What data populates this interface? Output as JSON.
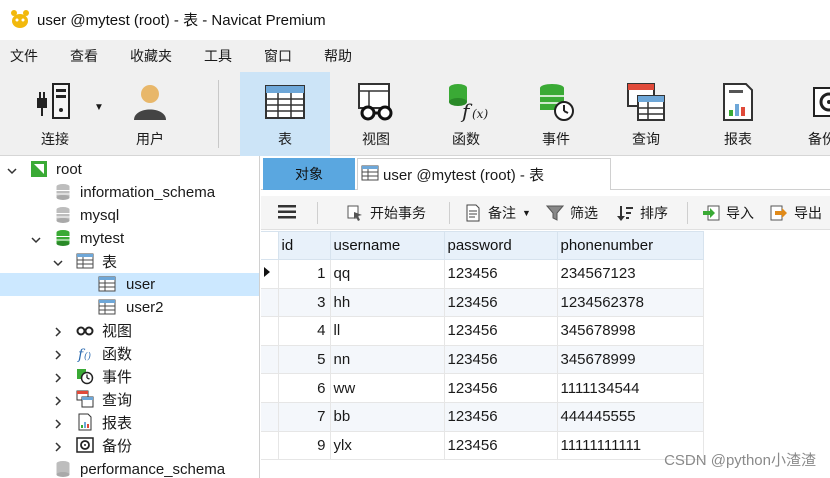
{
  "window": {
    "title": "user @mytest (root) - 表 - Navicat Premium"
  },
  "menu": [
    "文件",
    "查看",
    "收藏夹",
    "工具",
    "窗口",
    "帮助"
  ],
  "toolbar": {
    "connect": "连接",
    "user": "用户",
    "table": "表",
    "view": "视图",
    "function": "函数",
    "event": "事件",
    "query": "查询",
    "report": "报表",
    "backup": "备份"
  },
  "tree": {
    "root": "root",
    "dbs": [
      "information_schema",
      "mysql",
      "mytest"
    ],
    "tables_label": "表",
    "tables": [
      "user",
      "user2"
    ],
    "objects": [
      "视图",
      "函数",
      "事件",
      "查询",
      "报表",
      "备份"
    ],
    "last_db": "performance_schema"
  },
  "tabs": {
    "objects": "对象",
    "current": "user @mytest (root) - 表"
  },
  "objbar": {
    "begin_tx": "开始事务",
    "note": "备注",
    "filter": "筛选",
    "sort": "排序",
    "import": "导入",
    "export": "导出"
  },
  "grid": {
    "columns": [
      "id",
      "username",
      "password",
      "phonenumber"
    ],
    "rows": [
      [
        "1",
        "qq",
        "123456",
        "234567123"
      ],
      [
        "3",
        "hh",
        "123456",
        "1234562378"
      ],
      [
        "4",
        "ll",
        "123456",
        "345678998"
      ],
      [
        "5",
        "nn",
        "123456",
        "345678999"
      ],
      [
        "6",
        "ww",
        "123456",
        "1111134544"
      ],
      [
        "7",
        "bb",
        "123456",
        "444445555"
      ],
      [
        "9",
        "ylx",
        "123456",
        "11111111111"
      ]
    ]
  },
  "watermark": "CSDN @python小渣渣",
  "colors": {
    "accent": "#5aa7e0",
    "selection": "#cce8ff",
    "db_green": "#3aaa35"
  }
}
